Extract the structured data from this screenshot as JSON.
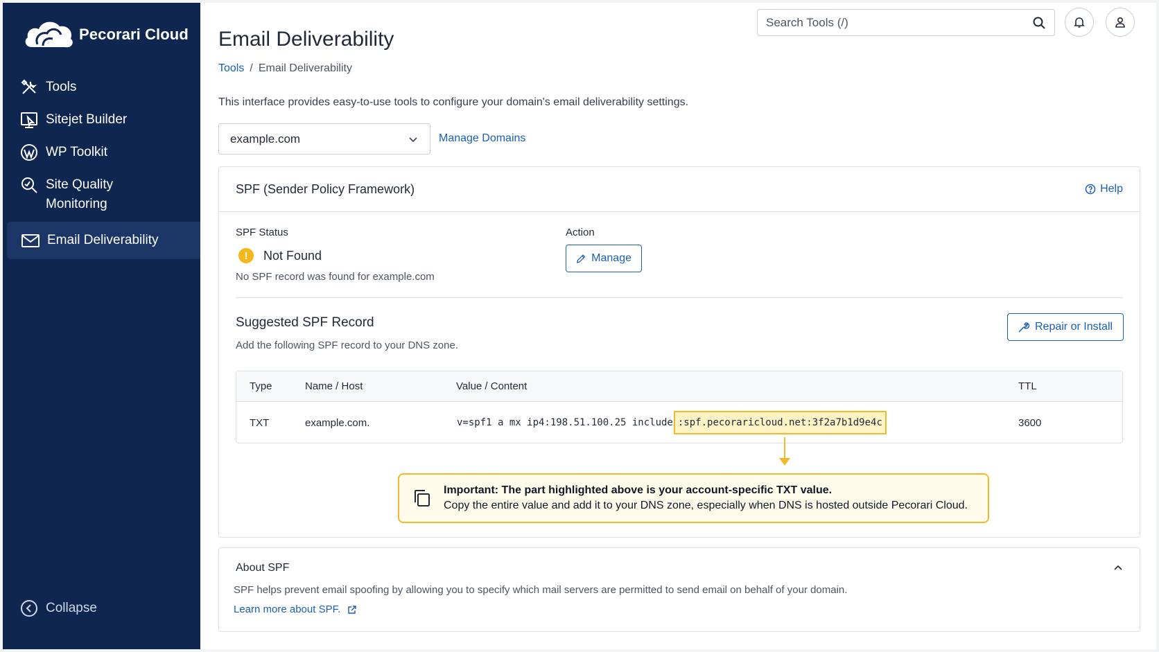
{
  "app": {
    "name": "Pecorari Cloud"
  },
  "sidebar": {
    "items": [
      {
        "label": "Tools",
        "icon": "tools-icon"
      },
      {
        "label": "Sitejet Builder",
        "icon": "sitejet-icon"
      },
      {
        "label": "WP Toolkit",
        "icon": "wordpress-icon"
      },
      {
        "label": "Site Quality",
        "label2": "Monitoring",
        "icon": "site-quality-icon"
      },
      {
        "label": "Email Deliverability",
        "icon": "envelope-icon",
        "active": true
      }
    ],
    "collapse_label": "Collapse"
  },
  "topbar": {
    "search_placeholder": "Search Tools (/)"
  },
  "page": {
    "title": "Email Deliverability",
    "breadcrumb": {
      "root": "Tools",
      "separator": "/",
      "current": "Email Deliverability"
    },
    "intro": "This interface provides easy-to-use tools to configure your domain's email deliverability settings."
  },
  "domain": {
    "selected": "example.com",
    "manage_label": "Manage Domains"
  },
  "spf_card": {
    "title": "SPF (Sender Policy Framework)",
    "help_label": "Help",
    "status_label": "SPF Status",
    "status_value": "Not Found",
    "status_note": "No SPF record was found for example.com",
    "action_label": "Action",
    "manage_button": "Manage",
    "suggested_title": "Suggested SPF Record",
    "suggested_note": "Add the following SPF record to your DNS zone.",
    "repair_button": "Repair or Install",
    "table": {
      "headers": [
        "Type",
        "Name / Host",
        "Value / Content",
        "TTL"
      ],
      "row": {
        "type": "TXT",
        "name": "example.com.",
        "value_prefix": "v=spf1 a mx ip4:198.51.100.25 include",
        "value_highlight": ":spf.pecoraricloud.net:3f2a7b1d9e4c",
        "ttl": "3600"
      }
    },
    "notice": {
      "title": "Important: The part highlighted above is your account-specific TXT value.",
      "body": "Copy the entire value and add it to your DNS zone, especially when DNS is hosted outside Pecorari Cloud."
    }
  },
  "about": {
    "title": "About SPF",
    "body": "SPF helps prevent email spoofing by allowing you to specify which mail servers are permitted to send email on behalf of your domain.",
    "link": "Learn more about SPF."
  },
  "colors": {
    "sidebar": "#0f2650",
    "accent": "#1a5fb4",
    "warning": "#f2b92a"
  }
}
